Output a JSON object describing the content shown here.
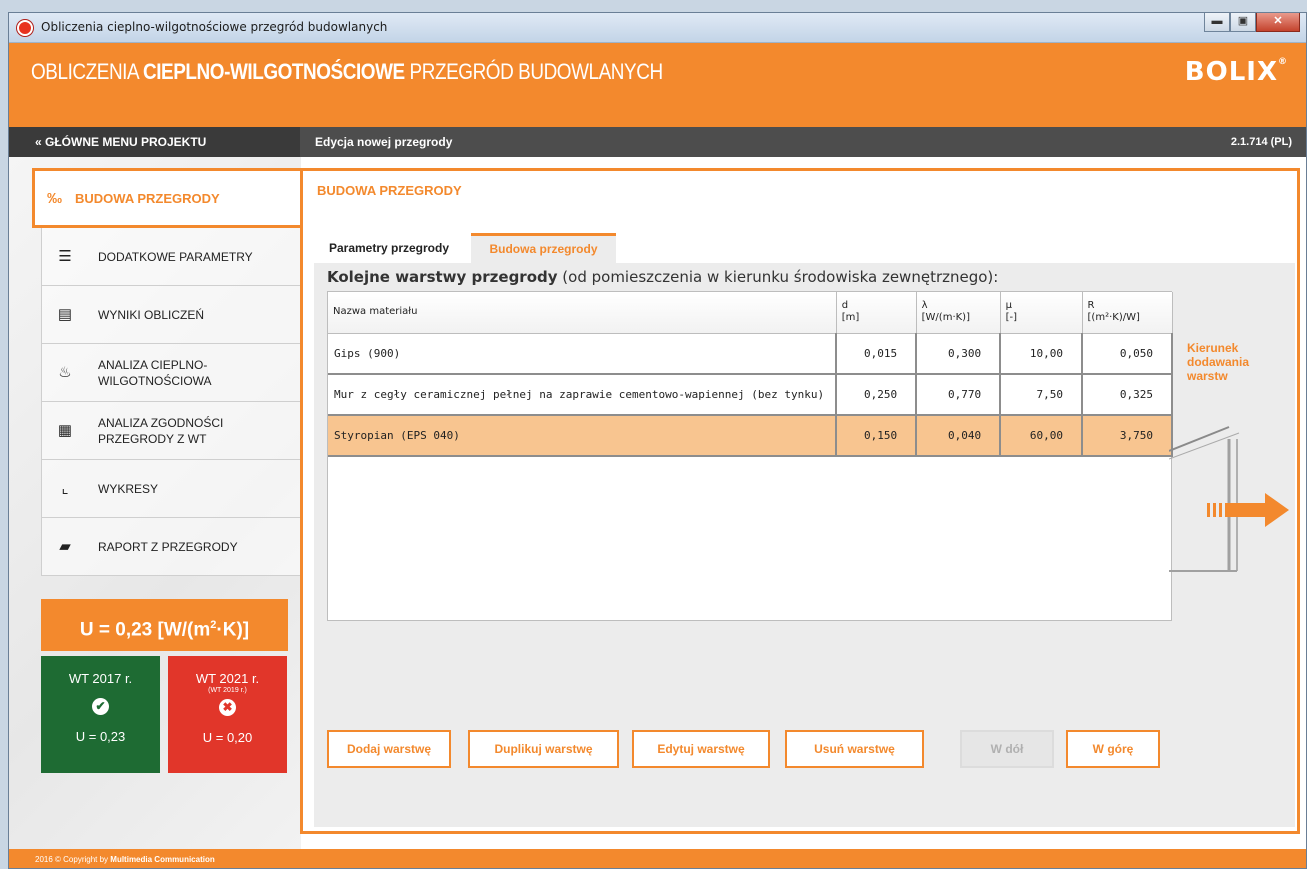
{
  "window": {
    "title": "Obliczenia cieplno-wilgotnościowe przegród budowlanych",
    "minimize": "▬",
    "maximize": "▣",
    "close": "✕"
  },
  "header": {
    "title_part1": "OBLICZENIA ",
    "title_part2": "CIEPLNO-WILGOTNOŚCIOWE",
    "title_part3": " PRZEGRÓD BUDOWLANYCH",
    "logo": "BOLIX",
    "logo_mark": "®"
  },
  "navbar": {
    "back": "« GŁÓWNE MENU PROJEKTU",
    "crumb": "Edycja nowej przegrody",
    "version": "2.1.714 (PL)"
  },
  "sidebar": {
    "active": {
      "label": "BUDOWA PRZEGRODY",
      "icon": "‰"
    },
    "items": [
      {
        "label": "DODATKOWE PARAMETRY",
        "icon": "☰"
      },
      {
        "label": "WYNIKI OBLICZEŃ",
        "icon": "▤"
      },
      {
        "label": "ANALIZA CIEPLNO-WILGOTNOŚCIOWA",
        "icon": "♨"
      },
      {
        "label": "ANALIZA ZGODNOŚCI PRZEGRODY Z WT",
        "icon": "▦"
      },
      {
        "label": "WYKRESY",
        "icon": "⌞"
      },
      {
        "label": "RAPORT Z PRZEGRODY",
        "icon": "▰"
      }
    ]
  },
  "result": {
    "u_prefix": "U = 0,23 [W/(m",
    "u_sup": "2",
    "u_suffix": "·K)]"
  },
  "wt2017": {
    "year": "WT 2017 r.",
    "mark": "✔",
    "u": "U = 0,23"
  },
  "wt2021": {
    "year": "WT 2021 r.",
    "sub": "(WT 2019 r.)",
    "mark": "✖",
    "u": "U = 0,20"
  },
  "main": {
    "heading": "BUDOWA PRZEGRODY",
    "tab_params": "Parametry przegrody",
    "tab_budowa": "Budowa przegrody"
  },
  "panel": {
    "title_bold": "Kolejne warstwy przegrody",
    "title_rest": " (od pomieszczenia w kierunku środowiska zewnętrznego):"
  },
  "table": {
    "headers": [
      {
        "name": "Nazwa materiału",
        "unit": ""
      },
      {
        "name": "d",
        "unit": "[m]"
      },
      {
        "name": "λ",
        "unit": "[W/(m·K)]"
      },
      {
        "name": "μ",
        "unit": "[-]"
      },
      {
        "name": "R",
        "unit": "[(m²·K)/W]"
      }
    ],
    "rows": [
      {
        "name": "Gips (900)",
        "d": "0,015",
        "lambda": "0,300",
        "mu": "10,00",
        "r": "0,050"
      },
      {
        "name": "Mur z cegły ceramicznej pełnej na zaprawie cementowo-wapiennej (bez tynku)",
        "d": "0,250",
        "lambda": "0,770",
        "mu": "7,50",
        "r": "0,325"
      },
      {
        "name": "Styropian (EPS 040)",
        "d": "0,150",
        "lambda": "0,040",
        "mu": "60,00",
        "r": "3,750"
      }
    ]
  },
  "buttons": {
    "add": "Dodaj warstwę",
    "duplicate": "Duplikuj warstwę",
    "edit": "Edytuj warstwę",
    "delete": "Usuń warstwę",
    "down": "W dół",
    "up": "W górę"
  },
  "direction": {
    "line1": "Kierunek",
    "line2": "dodawania",
    "line3": "warstw"
  },
  "footer": {
    "prefix": "2016 © Copyright by ",
    "company": "Multimedia Communication"
  },
  "colors": {
    "accent": "#f3892d",
    "dark": "#4d4d4d",
    "pass": "#1e6b33",
    "fail": "#e1362a",
    "selected_row": "#f8c590"
  }
}
